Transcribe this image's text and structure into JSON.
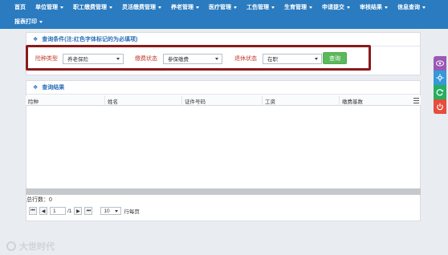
{
  "nav": {
    "row1": [
      "首页",
      "单位管理",
      "职工缴费管理",
      "灵活缴费管理",
      "养老管理",
      "医疗管理",
      "工伤管理",
      "生育管理",
      "申请提交",
      "审核结果",
      "信息查询"
    ],
    "row2": [
      "报表打印"
    ]
  },
  "query": {
    "title": "查询条件(注:红色字体标记的为必填项)",
    "labels": {
      "type": "险种类型",
      "pay_status": "缴费状态",
      "retire_status": "退休状态"
    },
    "values": {
      "type": "养老保险",
      "pay_status": "参保缴费",
      "retire_status": "在职"
    },
    "submit_label": "查询"
  },
  "result": {
    "title": "查询结果",
    "columns": [
      "险种",
      "姓名",
      "证件号码",
      "工资",
      "缴费基数"
    ]
  },
  "footer": {
    "total_label": "总行数：0",
    "page_current": "1",
    "page_total_text": "/1",
    "page_size": "10",
    "page_size_suffix": "行每页"
  },
  "sidetools": [
    {
      "icon": "eye-icon",
      "color": "#9b59b6"
    },
    {
      "icon": "settings-icon",
      "color": "#3498db"
    },
    {
      "icon": "refresh-icon",
      "color": "#27ae60"
    },
    {
      "icon": "power-icon",
      "color": "#e74c3c"
    }
  ],
  "watermark": "大世时代"
}
